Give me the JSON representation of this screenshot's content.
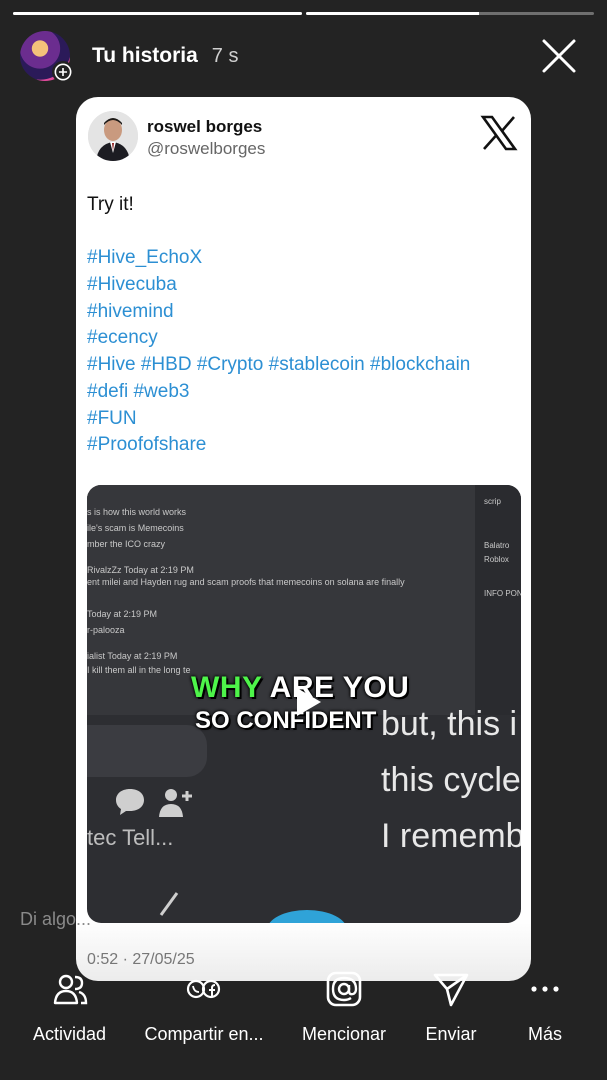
{
  "story": {
    "progress_segments": [
      1.0,
      0.6
    ],
    "username": "Tu historia",
    "time_ago": "7 s"
  },
  "post": {
    "author_name": "roswel borges",
    "author_handle": "@roswelborges",
    "lines": [
      {
        "text": "Try it!",
        "kind": "plain"
      },
      {
        "text": "",
        "kind": "blank"
      },
      {
        "text": "#Hive_EchoX",
        "kind": "tag"
      },
      {
        "text": "#Hivecuba",
        "kind": "tag"
      },
      {
        "text": "#hivemind",
        "kind": "tag"
      },
      {
        "text": "#ecency",
        "kind": "tag"
      },
      {
        "text": "#Hive #HBD #Crypto #stablecoin #blockchain",
        "kind": "tag"
      },
      {
        "text": "#defi #web3",
        "kind": "tag"
      },
      {
        "text": "#FUN",
        "kind": "tag"
      },
      {
        "text": "#Proofofshare",
        "kind": "tag"
      }
    ],
    "video": {
      "caption_line1_highlight": "WHY",
      "caption_line1_rest": " ARE YOU",
      "caption_line2": "SO CONFIDENT",
      "chat_lines": [
        "s is how this world works",
        "ile's scam is Memecoins",
        "mber the ICO crazy",
        "RivalzZz  Today at 2:19 PM",
        "ent milei and Hayden rug and scam proofs that memecoins on solana are finally",
        "Today at 2:19 PM",
        "r-palooza",
        "ialist  Today at 2:19 PM",
        "I kill them all in the long te"
      ],
      "sidebar_lines": [
        "scrip",
        "Balatro",
        "Roblox",
        "INFO PON"
      ],
      "big_lines": [
        "but, this i",
        "this cycle",
        "I rememb"
      ],
      "menu_text": "tec Tell..."
    },
    "date": "0:52 · 27/05/25"
  },
  "reply_placeholder": "Di algo...",
  "actions": [
    {
      "label": "Actividad",
      "icon": "people-icon"
    },
    {
      "label": "Compartir en...",
      "icon": "share-apps-icon"
    },
    {
      "label": "Mencionar",
      "icon": "mention-icon"
    },
    {
      "label": "Enviar",
      "icon": "send-icon"
    },
    {
      "label": "Más",
      "icon": "more-icon"
    }
  ]
}
